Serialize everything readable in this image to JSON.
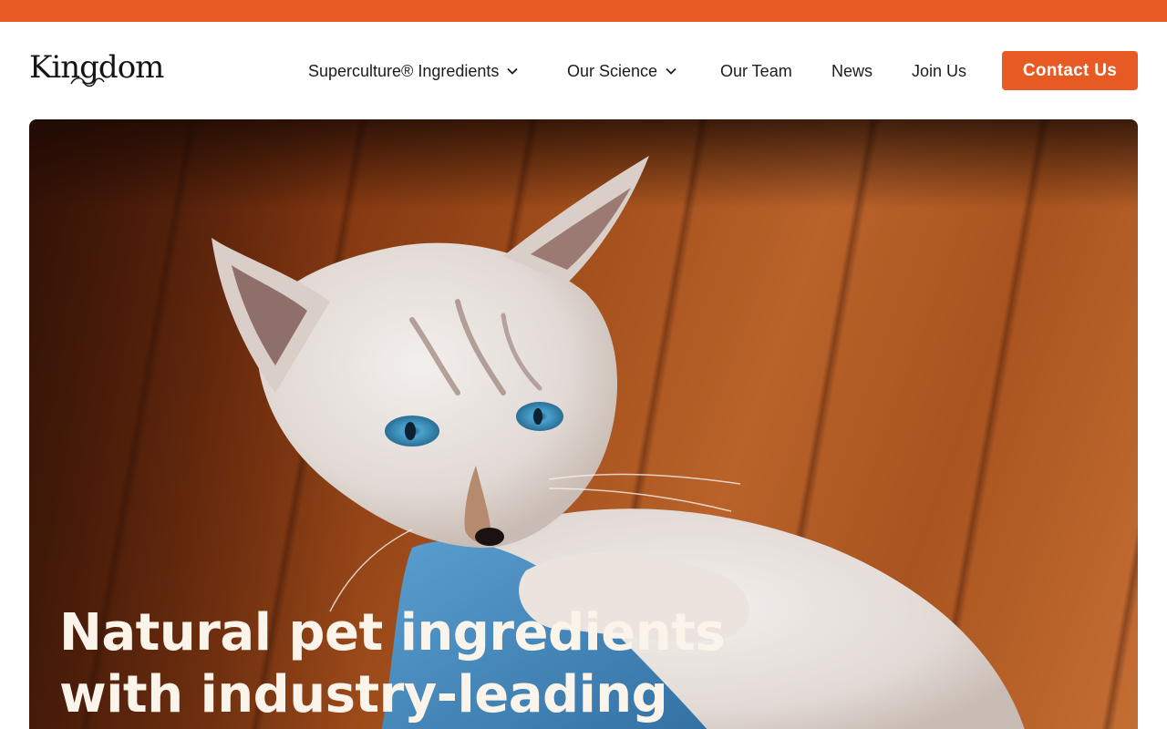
{
  "colors": {
    "accent": "#E85A24",
    "text": "#1c1c1c",
    "hero_text": "#FBF4EA"
  },
  "brand": {
    "logo_text": "Kingdom"
  },
  "nav": {
    "items": [
      {
        "label": "Superculture® Ingredients",
        "has_dropdown": true
      },
      {
        "label": "Our Science",
        "has_dropdown": true
      },
      {
        "label": "Our Team",
        "has_dropdown": false
      },
      {
        "label": "News",
        "has_dropdown": false
      },
      {
        "label": "Join Us",
        "has_dropdown": false
      }
    ],
    "cta_label": "Contact Us",
    "dropdown_icon": "chevron-down-icon"
  },
  "hero": {
    "image_subject": "white-cat-kitten-on-wooden-floor",
    "headline_lines": [
      "Natural pet ingredients",
      "with industry-leading"
    ]
  }
}
